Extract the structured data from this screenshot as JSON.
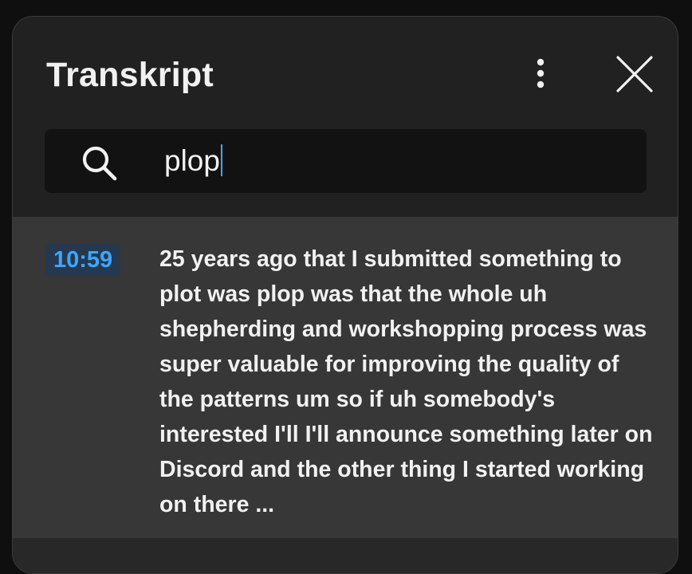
{
  "panel": {
    "title": "Transkript",
    "more_icon": "more-vertical-icon",
    "close_icon": "close-icon"
  },
  "search": {
    "icon": "search-icon",
    "value": "plop"
  },
  "segments": [
    {
      "timestamp": "10:59",
      "text": "25 years ago that I submitted something to plot was plop was that the whole uh shepherding and workshopping process was super valuable for improving the quality of the patterns um so if uh somebody's interested I'll I'll announce something later on Discord and the other thing I started working on there ..."
    }
  ],
  "colors": {
    "panel_bg": "#212121",
    "search_bg": "#121212",
    "segment_bg": "#373737",
    "accent": "#3ea6ff",
    "text": "#f1f1f1"
  }
}
